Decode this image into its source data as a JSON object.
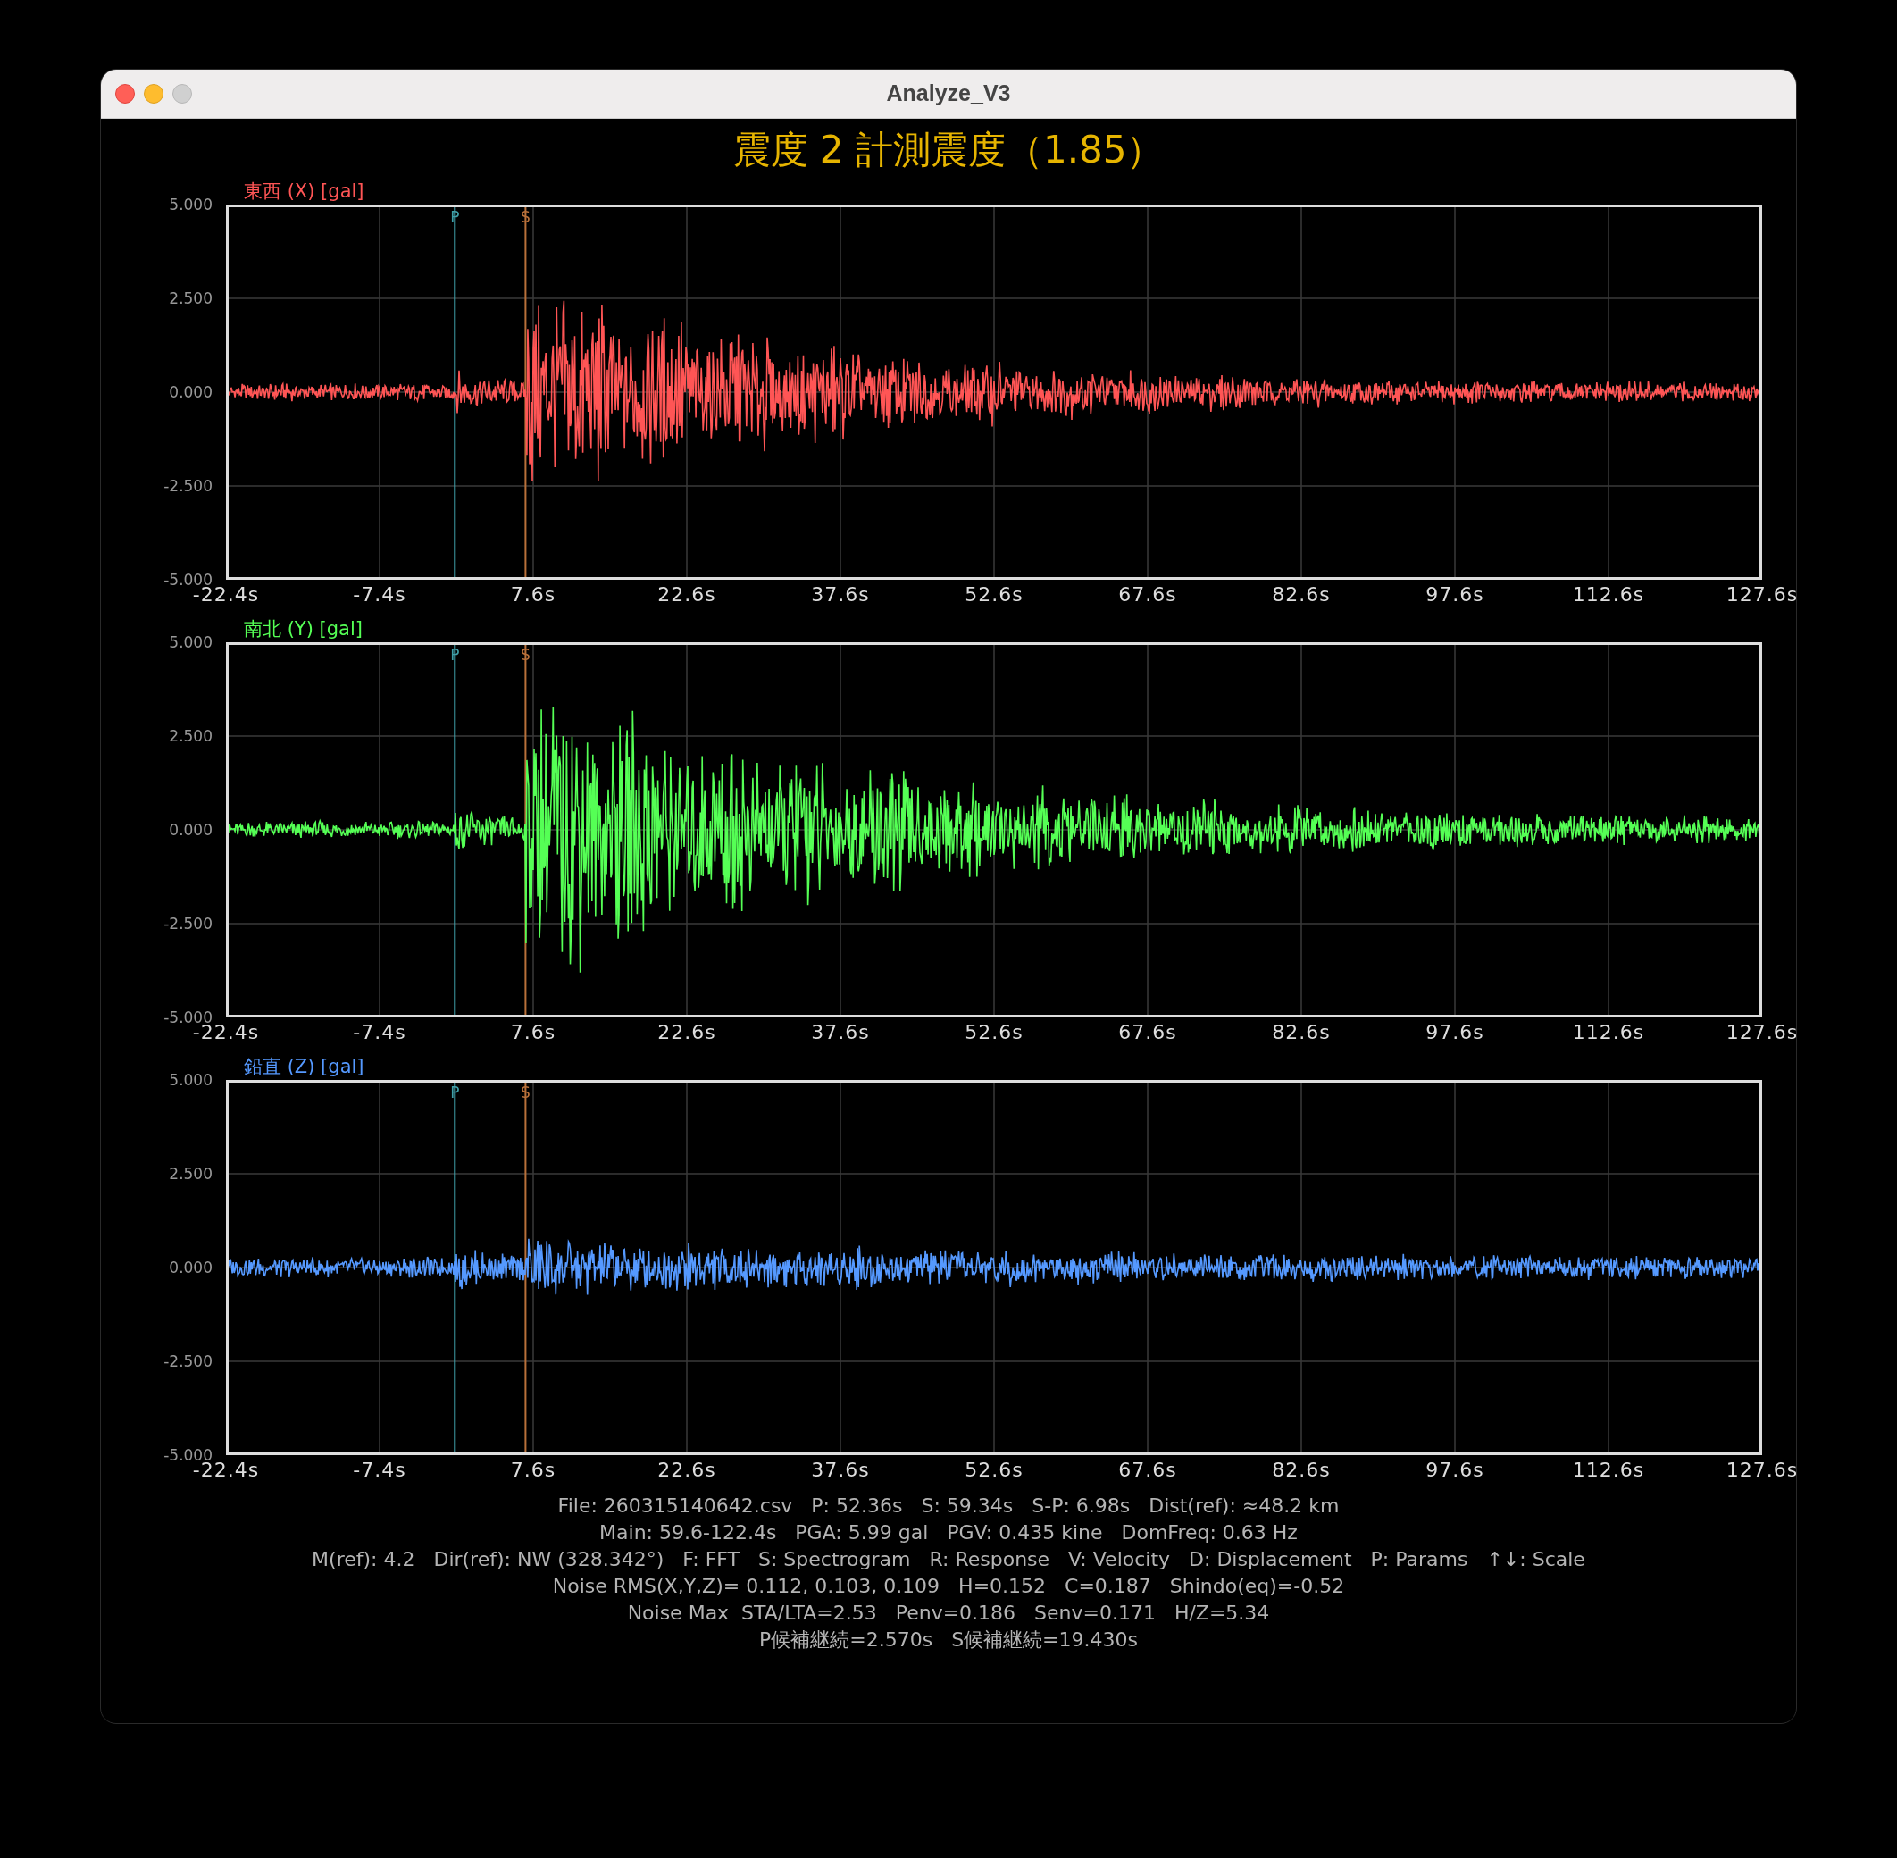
{
  "window": {
    "title": "Analyze_V3"
  },
  "heading": "震度 2 計測震度（1.85）",
  "panels": [
    {
      "label": "東西 (X) [gal]",
      "color": "#ff5555",
      "p_marker": "P",
      "s_marker": "S",
      "yticks": [
        "5.000",
        "2.500",
        "0.000",
        "-2.500",
        "-5.000"
      ],
      "xticks": [
        "-22.4s",
        "-7.4s",
        "7.6s",
        "22.6s",
        "37.6s",
        "52.6s",
        "67.6s",
        "82.6s",
        "97.6s",
        "112.6s",
        "127.6s"
      ]
    },
    {
      "label": "南北 (Y) [gal]",
      "color": "#55ff55",
      "p_marker": "P",
      "s_marker": "S",
      "yticks": [
        "5.000",
        "2.500",
        "0.000",
        "-2.500",
        "-5.000"
      ],
      "xticks": [
        "-22.4s",
        "-7.4s",
        "7.6s",
        "22.6s",
        "37.6s",
        "52.6s",
        "67.6s",
        "82.6s",
        "97.6s",
        "112.6s",
        "127.6s"
      ]
    },
    {
      "label": "鉛直 (Z) [gal]",
      "color": "#5599ff",
      "p_marker": "P",
      "s_marker": "S",
      "yticks": [
        "5.000",
        "2.500",
        "0.000",
        "-2.500",
        "-5.000"
      ],
      "xticks": [
        "-22.4s",
        "-7.4s",
        "7.6s",
        "22.6s",
        "37.6s",
        "52.6s",
        "67.6s",
        "82.6s",
        "97.6s",
        "112.6s",
        "127.6s"
      ]
    }
  ],
  "info_lines": [
    "File: 260315140642.csv   P: 52.36s   S: 59.34s   S-P: 6.98s   Dist(ref): ≈48.2 km",
    "Main: 59.6-122.4s   PGA: 5.99 gal   PGV: 0.435 kine   DomFreq: 0.63 Hz",
    "M(ref): 4.2   Dir(ref): NW (328.342°)   F: FFT   S: Spectrogram   R: Response   V: Velocity   D: Displacement   P: Params   ↑↓: Scale",
    "Noise RMS(X,Y,Z)= 0.112, 0.103, 0.109   H=0.152   C=0.187   Shindo(eq)=-0.52",
    "Noise Max  STA/LTA=2.53   Penv=0.186   Senv=0.171   H/Z=5.34",
    "P候補継続=2.570s   S候補継続=19.430s"
  ]
}
